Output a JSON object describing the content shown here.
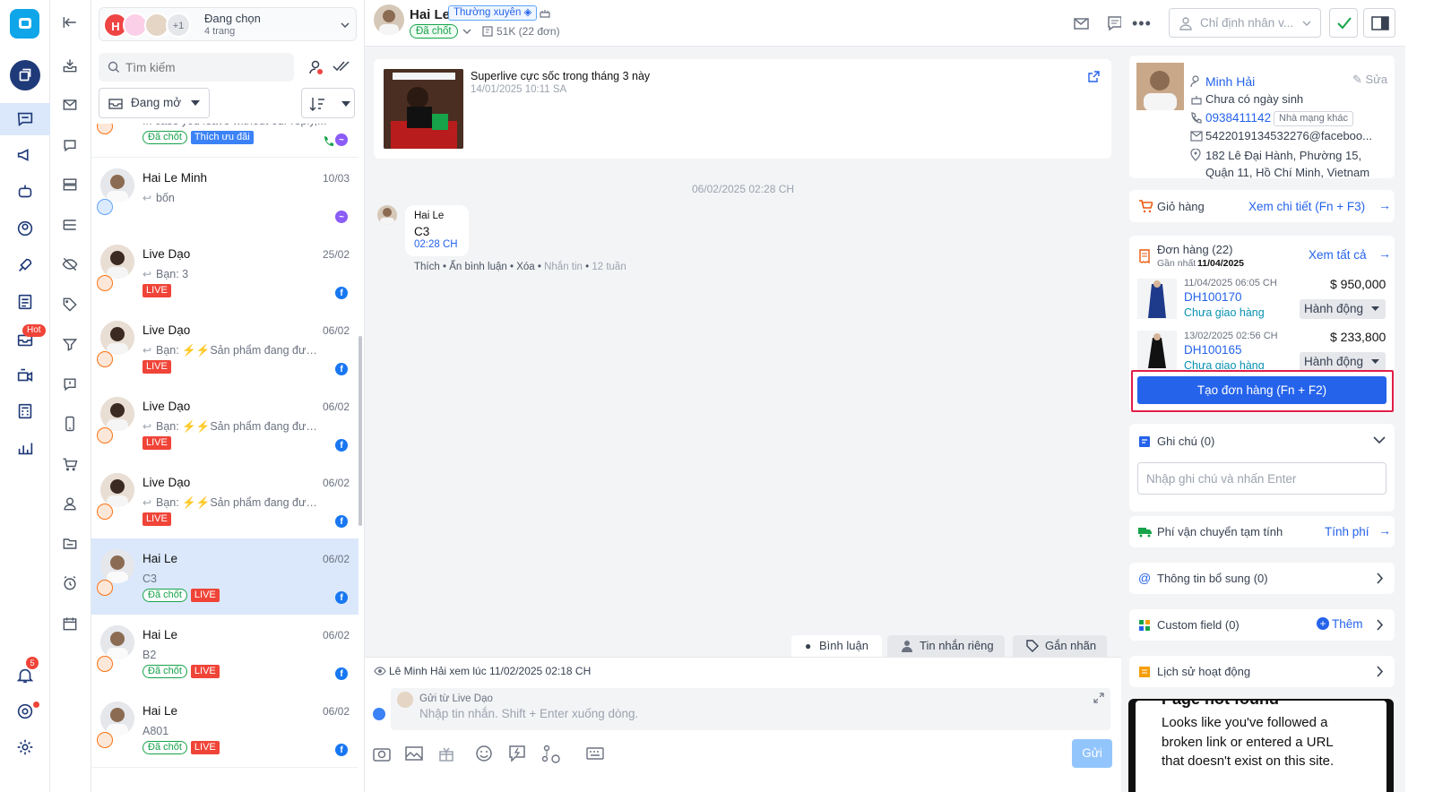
{
  "rail": {
    "inbox_badge": "Hot",
    "notif_count": "5"
  },
  "page_selector": {
    "label": "Đang chọn",
    "count": "4 trang",
    "extra": "+1",
    "initial": "H"
  },
  "search": {
    "placeholder": "Tìm kiếm"
  },
  "filter": {
    "status": "Đang mở"
  },
  "conversations": [
    {
      "name": "",
      "date": "",
      "msg": "In case you leave without our reply,...",
      "tags": [
        "Đã chốt",
        "Thích ưu đãi"
      ]
    },
    {
      "name": "Hai Le Minh",
      "date": "10/03",
      "msg": "bốn",
      "tags": []
    },
    {
      "name": "Live Dạo",
      "date": "25/02",
      "msg": "Bạn: 3",
      "tags": [
        "LIVE"
      ]
    },
    {
      "name": "Live Dạo",
      "date": "06/02",
      "msg": "Bạn: ⚡⚡Sản phẩm đang được đề...",
      "tags": [
        "LIVE"
      ]
    },
    {
      "name": "Live Dạo",
      "date": "06/02",
      "msg": "Bạn: ⚡⚡Sản phẩm đang được đề...",
      "tags": [
        "LIVE"
      ]
    },
    {
      "name": "Live Dạo",
      "date": "06/02",
      "msg": "Bạn: ⚡⚡Sản phẩm đang được đề...",
      "tags": [
        "LIVE"
      ]
    },
    {
      "name": "Hai Le",
      "date": "06/02",
      "msg": "C3",
      "tags": [
        "Đã chốt",
        "LIVE"
      ]
    },
    {
      "name": "Hai Le",
      "date": "06/02",
      "msg": "B2",
      "tags": [
        "Đã chốt",
        "LIVE"
      ]
    },
    {
      "name": "Hai Le",
      "date": "06/02",
      "msg": "A801",
      "tags": [
        "Đã chốt",
        "LIVE"
      ]
    }
  ],
  "header": {
    "name": "Hai Le",
    "badge": "Thường xuyên",
    "status": "Đã chốt",
    "stats": "51K (22 đơn)",
    "assign_placeholder": "Chỉ định nhân v..."
  },
  "post": {
    "title": "Superlive cực sốc trong tháng 3 này",
    "time": "14/01/2025 10:11 SA"
  },
  "chat": {
    "date_sep": "06/02/2025 02:28 CH",
    "sender": "Hai Le",
    "text": "C3",
    "time": "02:28 CH",
    "actions": [
      "Thích",
      "Ẩn bình luận",
      "Xóa",
      "Nhắn tin",
      "12 tuần"
    ]
  },
  "reply_tabs": [
    "Bình luận",
    "Tin nhắn riêng",
    "Gắn nhãn"
  ],
  "seen": "Lê Minh Hải xem lúc 11/02/2025 02:18 CH",
  "composer": {
    "from": "Gửi từ Live Dạo",
    "placeholder": "Nhập tin nhắn. Shift + Enter xuống dòng.",
    "send": "Gửi"
  },
  "customer": {
    "name": "Minh Hải",
    "edit": "Sửa",
    "birthday": "Chưa có ngày sinh",
    "phone": "0938411142",
    "carrier": "Nhà mạng khác",
    "email": "5422019134532276@faceboo...",
    "address": "182 Lê Đại Hành, Phường 15, Quận 11, Hồ Chí Minh, Vietnam"
  },
  "cart": {
    "label": "Giỏ hàng",
    "link": "Xem chi tiết (Fn + F3)"
  },
  "orders": {
    "title": "Đơn hàng (22)",
    "latest_label": "Gần nhất",
    "latest_date": "11/04/2025",
    "view_all": "Xem tất cả",
    "create": "Tạo đơn hàng (Fn + F2)",
    "items": [
      {
        "time": "11/04/2025 06:05 CH",
        "code": "DH100170",
        "status": "Chưa giao hàng",
        "amount": "$ 950,000",
        "action": "Hành động"
      },
      {
        "time": "13/02/2025 02:56 CH",
        "code": "DH100165",
        "status": "Chưa giao hàng",
        "amount": "$ 233,800",
        "action": "Hành động"
      }
    ]
  },
  "notes": {
    "title": "Ghi chú (0)",
    "placeholder": "Nhập ghi chú và nhấn Enter"
  },
  "shipping": {
    "label": "Phí vận chuyển tạm tính",
    "link": "Tính phí"
  },
  "extra_info": {
    "label": "Thông tin bổ sung (0)"
  },
  "custom_field": {
    "label": "Custom field (0)",
    "add": "Thêm"
  },
  "history": {
    "label": "Lịch sử hoạt động"
  },
  "notfound": {
    "title": "Page not found",
    "text": "Looks like you've followed a broken link or entered a URL that doesn't exist on this site."
  },
  "colors": {
    "primary": "#2563eb",
    "accent_red": "#f04438",
    "green": "#16a34a"
  }
}
